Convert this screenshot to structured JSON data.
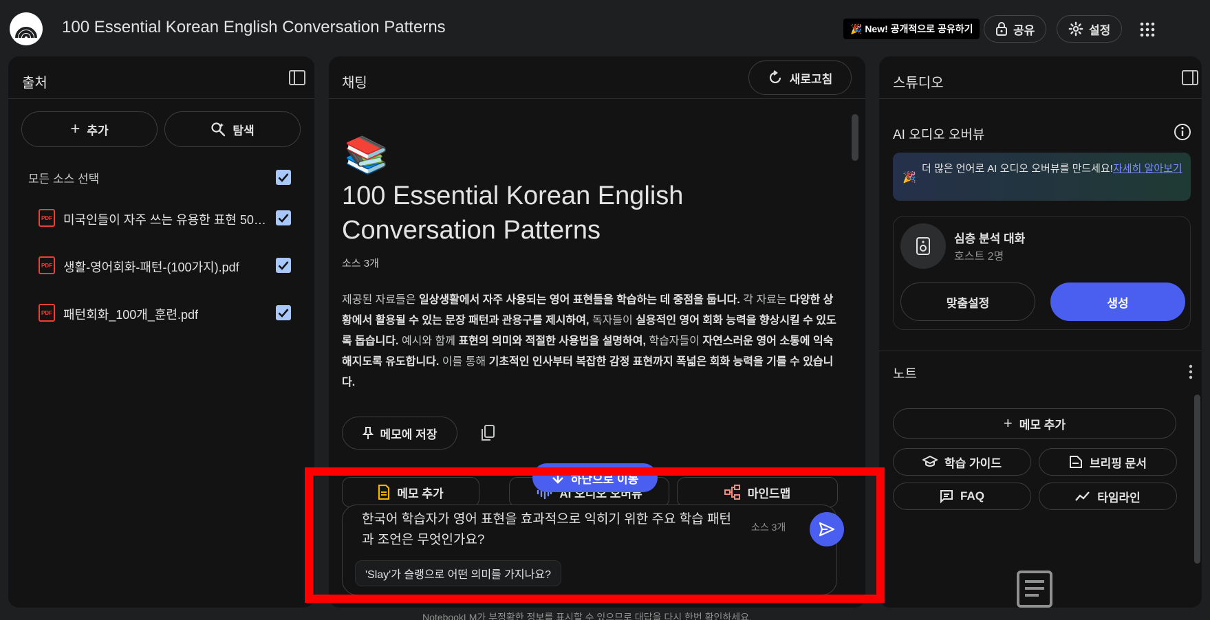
{
  "app": {
    "title": "100 Essential Korean English Conversation Patterns",
    "new_badge": "🎉 New! 공개적으로 공유하기",
    "share_label": "공유",
    "settings_label": "설정"
  },
  "sources": {
    "title": "출처",
    "add_label": "추가",
    "explore_label": "탐색",
    "select_all_label": "모든 소스 선택",
    "items": [
      {
        "label": "미국인들이 자주 쓰는 유용한 표현 500..."
      },
      {
        "label": "생활-영어회화-패턴-(100가지).pdf"
      },
      {
        "label": "패턴회화_100개_훈련.pdf"
      }
    ],
    "pdf_badge": "PDF"
  },
  "chat": {
    "title": "채팅",
    "refresh_label": "새로고침",
    "notebook_emoji": "📚",
    "notebook_title": "100 Essential Korean English Conversation Patterns",
    "source_count": "소스 3개",
    "summary_parts": [
      {
        "t": "제공된 자료들은 ",
        "b": false
      },
      {
        "t": "일상생활에서 자주 사용되는 영어 표현들을 학습하는 데 중점을 둡니다.",
        "b": true
      },
      {
        "t": " 각 자료는 ",
        "b": false
      },
      {
        "t": "다양한 상황에서 활용될 수 있는 문장 패턴과 관용구를 제시하여,",
        "b": true
      },
      {
        "t": " 독자들이 ",
        "b": false
      },
      {
        "t": "실용적인 영어 회화 능력을 향상시킬 수 있도록 돕습니다.",
        "b": true
      },
      {
        "t": " 예시와 함께 ",
        "b": false
      },
      {
        "t": "표현의 의미와 적절한 사용법을 설명하여,",
        "b": true
      },
      {
        "t": " 학습자들이 ",
        "b": false
      },
      {
        "t": "자연스러운 영어 소통에 익숙해지도록 유도합니다.",
        "b": true
      },
      {
        "t": " 이를 통해 ",
        "b": false
      },
      {
        "t": "기초적인 인사부터 복잡한 감정 표현까지 폭넓은 회화 능력을 기를 수 있습니다.",
        "b": true
      }
    ],
    "save_memo_label": "메모에 저장",
    "scroll_down_label": "하단으로 이동",
    "actions": {
      "add_memo": "메모 추가",
      "audio_overview": "AI 오디오 오버뷰",
      "mindmap": "마인드맵"
    },
    "input_text": "한국어 학습자가 영어 표현을 효과적으로 익히기 위한 주요 학습 패턴과 조언은 무엇인가요?",
    "input_source_count": "소스 3개",
    "suggestion": "'Slay'가 슬랭으로 어떤 의미를 가지나요?",
    "disclaimer": "NotebookLM가 부정확한 정보를 표시할 수 있으므로 대답을 다시 한번 확인하세요."
  },
  "studio": {
    "title": "스튜디오",
    "audio_title": "AI 오디오 오버뷰",
    "promo_text": "더 많은 언어로 AI 오디오 오버뷰를 만드세요!",
    "promo_link": "자세히 알아보기",
    "deep_dive_title": "심층 분석 대화",
    "deep_dive_sub": "호스트 2명",
    "customize_label": "맞춤설정",
    "generate_label": "생성",
    "notes_title": "노트",
    "add_note_label": "메모 추가",
    "study_guide": "학습 가이드",
    "briefing_doc": "브리핑 문서",
    "faq": "FAQ",
    "timeline": "타임라인"
  },
  "colors": {
    "accent": "#4a5ef0",
    "checkbox": "#a8c7fa",
    "highlight": "#ff0000"
  }
}
